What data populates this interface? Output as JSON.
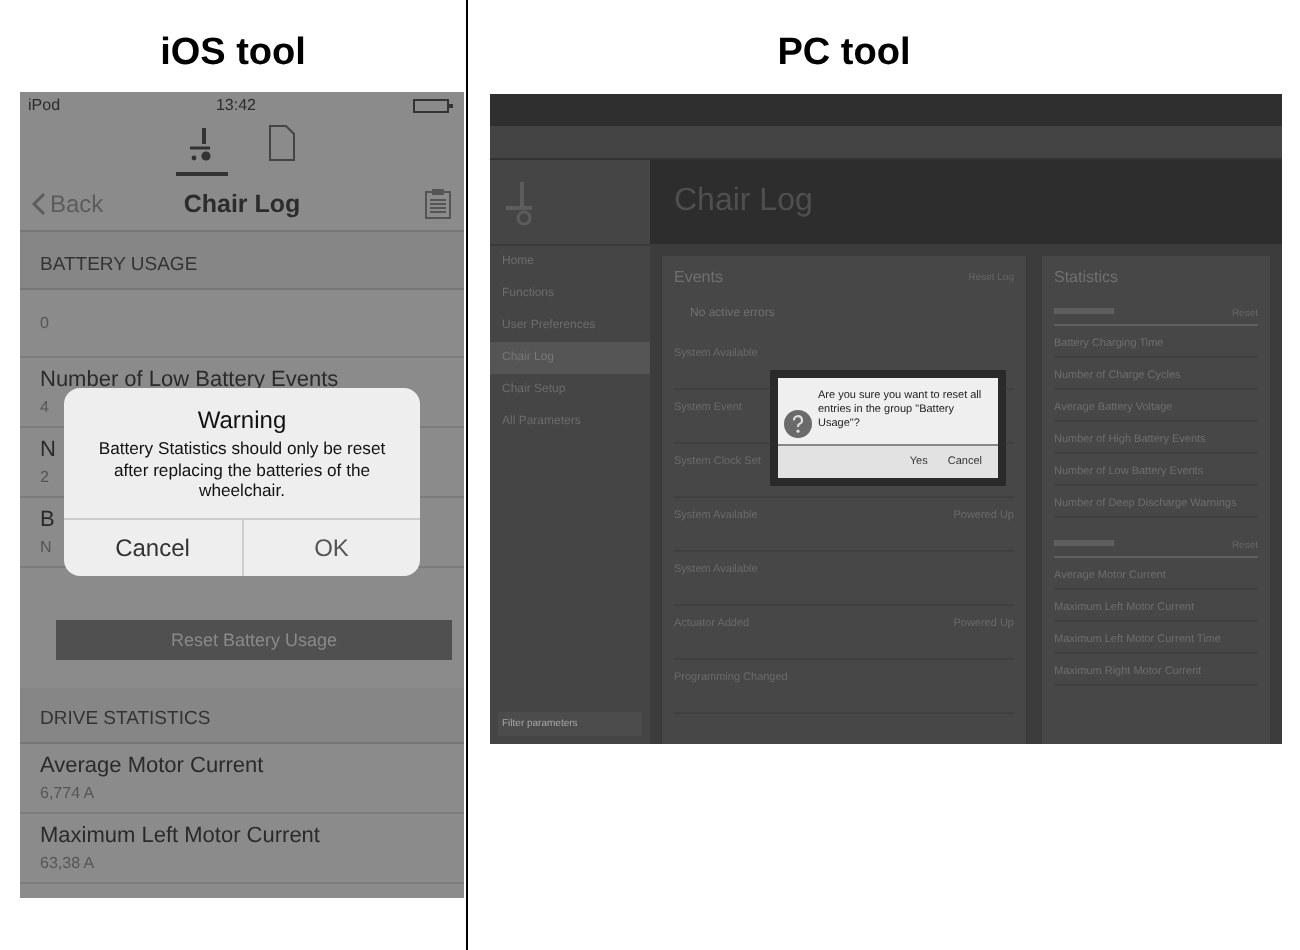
{
  "captions": [
    "iOS tool",
    "PC tool"
  ],
  "ios": {
    "status_bar": {
      "carrier": "iPod",
      "time": "13:42"
    },
    "tabs": [
      {
        "kind": "chair",
        "selected": true
      },
      {
        "kind": "document",
        "selected": false
      }
    ],
    "nav": {
      "back": "Back",
      "title": "Chair Log"
    },
    "sections": [
      {
        "title": "BATTERY USAGE",
        "rows": [
          {
            "value": "0"
          },
          {
            "label": "Number of Low Battery Events",
            "value": "4"
          },
          {
            "label": "N",
            "value": "2"
          },
          {
            "label": "B",
            "value": "N"
          }
        ],
        "button": "Reset Battery Usage"
      },
      {
        "title": "DRIVE STATISTICS",
        "rows": [
          {
            "label": "Average Motor Current",
            "value": "6,774 A"
          },
          {
            "label": "Maximum Left Motor Current",
            "value": "63,38 A"
          }
        ]
      }
    ],
    "alert": {
      "title": "Warning",
      "message": "Battery Statistics should only be reset after replacing the batteries of the wheelchair.",
      "buttons": [
        "Cancel",
        "OK"
      ]
    }
  },
  "pc": {
    "page_title": "Chair Log",
    "sidebar": {
      "items": [
        {
          "label": "Home",
          "selected": false
        },
        {
          "label": "Functions",
          "selected": false
        },
        {
          "label": "User Preferences",
          "selected": false
        },
        {
          "label": "Chair Log",
          "selected": true
        },
        {
          "label": "Chair Setup",
          "selected": false
        },
        {
          "label": "All Parameters",
          "selected": false
        }
      ],
      "search_placeholder": "Filter parameters"
    },
    "events": {
      "title": "Events",
      "reset": "Reset Log",
      "status": "No active errors",
      "items": [
        {
          "title": "System Available"
        },
        {
          "title": "System Event"
        },
        {
          "title": "System Clock Set"
        },
        {
          "title": "System Available",
          "note": "Powered Up"
        },
        {
          "title": "System Available"
        },
        {
          "title": "Actuator Added",
          "note": "Powered Up"
        },
        {
          "title": "Programming Changed"
        }
      ]
    },
    "statistics": {
      "title": "Statistics",
      "groups": [
        {
          "reset": "Reset",
          "rows": [
            "Battery Charging Time",
            "Number of Charge Cycles",
            "Average Battery Voltage",
            "Number of High Battery Events",
            "Number of Low Battery Events",
            "Number of Deep Discharge Warnings"
          ]
        },
        {
          "reset": "Reset",
          "rows": [
            "Average Motor Current",
            "Maximum Left Motor Current",
            "Maximum Left Motor Current Time",
            "Maximum Right Motor Current"
          ]
        }
      ]
    },
    "dialog": {
      "message": "Are you sure you want to reset all entries in the group \"Battery Usage\"?",
      "buttons": [
        "Yes",
        "Cancel"
      ]
    }
  }
}
